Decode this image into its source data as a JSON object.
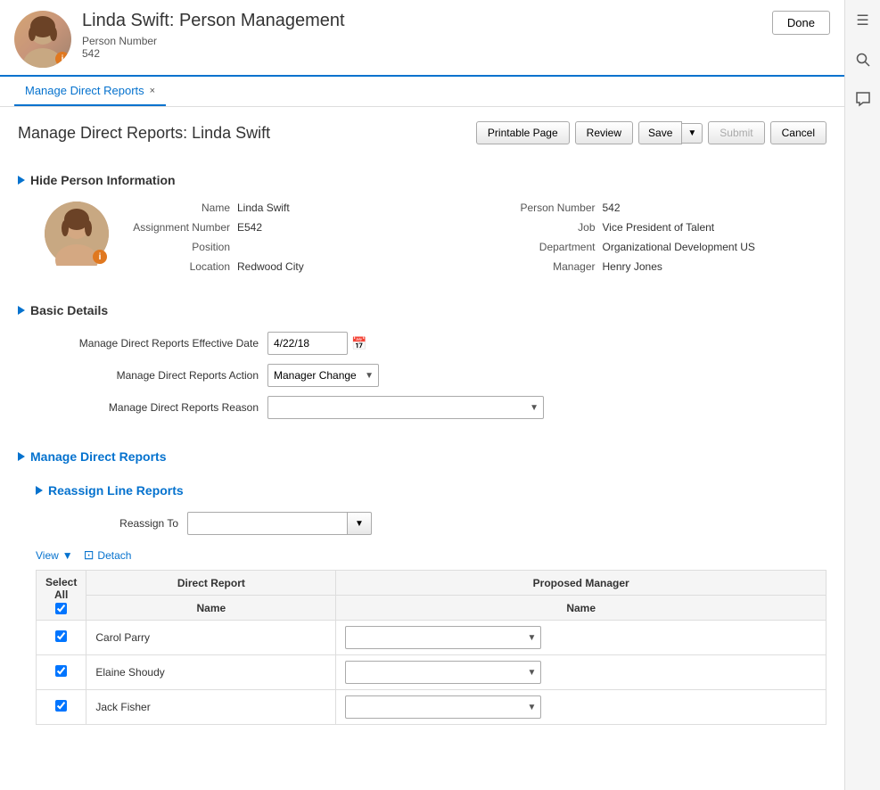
{
  "header": {
    "title": "Linda Swift: Person Management",
    "person_number_label": "Person Number",
    "person_number_value": "542",
    "done_button": "Done"
  },
  "tab": {
    "label": "Manage Direct Reports",
    "close_symbol": "×"
  },
  "page": {
    "title": "Manage Direct Reports: Linda Swift",
    "toolbar": {
      "printable_page": "Printable Page",
      "review": "Review",
      "save": "Save",
      "submit": "Submit",
      "cancel": "Cancel"
    }
  },
  "person_section": {
    "toggle_label": "Hide Person Information",
    "name_label": "Name",
    "name_value": "Linda Swift",
    "person_number_label": "Person Number",
    "person_number_value": "542",
    "assignment_number_label": "Assignment Number",
    "assignment_number_value": "E542",
    "job_label": "Job",
    "job_value": "Vice President of Talent",
    "position_label": "Position",
    "position_value": "",
    "department_label": "Department",
    "department_value": "Organizational Development US",
    "location_label": "Location",
    "location_value": "Redwood City",
    "manager_label": "Manager",
    "manager_value": "Henry Jones"
  },
  "basic_details": {
    "section_title": "Basic Details",
    "effective_date_label": "Manage Direct Reports Effective Date",
    "effective_date_value": "4/22/18",
    "action_label": "Manage Direct Reports Action",
    "action_value": "Manager Change",
    "reason_label": "Manage Direct Reports Reason",
    "reason_value": ""
  },
  "manage_direct_reports": {
    "section_title": "Manage Direct Reports",
    "reassign_section_title": "Reassign Line Reports",
    "reassign_to_label": "Reassign To",
    "reassign_to_value": "",
    "table": {
      "view_label": "View",
      "detach_label": "Detach",
      "select_all_label": "Select All",
      "col_direct_report": "Direct Report",
      "col_proposed_manager": "Proposed Manager",
      "col_name": "Name",
      "col_name2": "Name",
      "rows": [
        {
          "checked": true,
          "name": "Carol Parry",
          "proposed_manager": ""
        },
        {
          "checked": true,
          "name": "Elaine Shoudy",
          "proposed_manager": ""
        },
        {
          "checked": true,
          "name": "Jack Fisher",
          "proposed_manager": ""
        }
      ]
    }
  },
  "sidebar_icons": {
    "list": "☰",
    "search": "🔍",
    "chat": "💬"
  }
}
